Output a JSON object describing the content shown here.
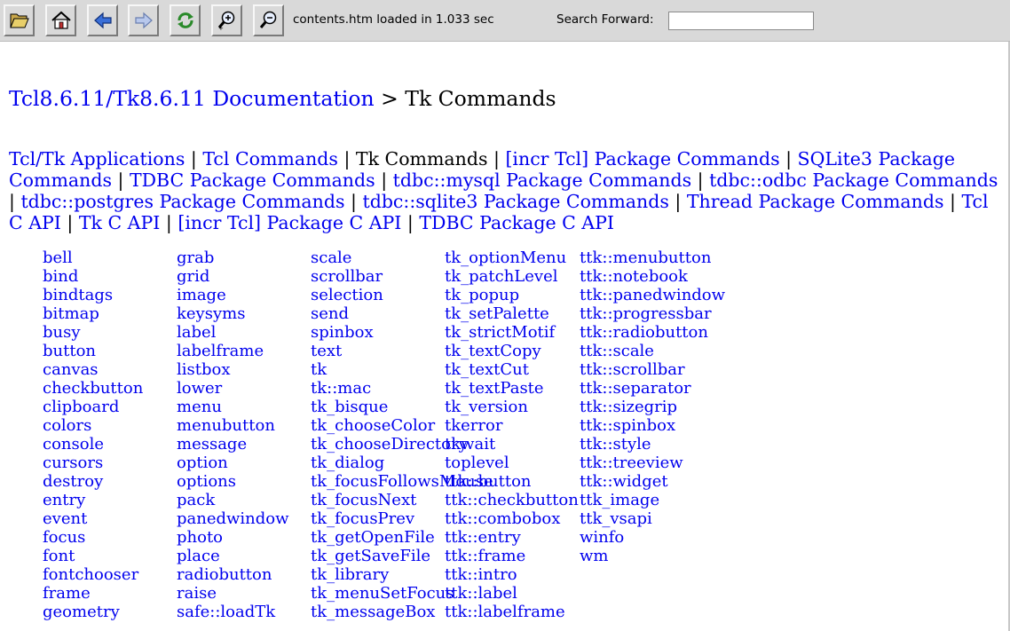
{
  "toolbar": {
    "buttons": [
      {
        "name": "open-folder-icon",
        "label": "Open"
      },
      {
        "name": "home-icon",
        "label": "Home"
      },
      {
        "name": "back-arrow-icon",
        "label": "Back"
      },
      {
        "name": "forward-arrow-icon",
        "label": "Forward"
      },
      {
        "name": "reload-icon",
        "label": "Reload"
      },
      {
        "name": "zoom-in-icon",
        "label": "Zoom in"
      },
      {
        "name": "zoom-out-icon",
        "label": "Zoom out"
      }
    ],
    "status": "contents.htm loaded in 1.033 sec",
    "search_label": "Search Forward:",
    "search_value": ""
  },
  "page": {
    "breadcrumb_link": "Tcl8.6.11/Tk8.6.11 Documentation",
    "breadcrumb_sep": " > ",
    "breadcrumb_current": "Tk Commands",
    "nav_links": [
      {
        "label": "Tcl/Tk Applications",
        "current": false
      },
      {
        "label": "Tcl Commands",
        "current": false
      },
      {
        "label": "Tk Commands",
        "current": true
      },
      {
        "label": "[incr Tcl] Package Commands",
        "current": false
      },
      {
        "label": "SQLite3 Package Commands",
        "current": false
      },
      {
        "label": "TDBC Package Commands",
        "current": false
      },
      {
        "label": "tdbc::mysql Package Commands",
        "current": false
      },
      {
        "label": "tdbc::odbc Package Commands",
        "current": false
      },
      {
        "label": "tdbc::postgres Package Commands",
        "current": false
      },
      {
        "label": "tdbc::sqlite3 Package Commands",
        "current": false
      },
      {
        "label": "Thread Package Commands",
        "current": false
      },
      {
        "label": "Tcl C API",
        "current": false
      },
      {
        "label": "Tk C API",
        "current": false
      },
      {
        "label": "[incr Tcl] Package C API",
        "current": false
      },
      {
        "label": "TDBC Package C API",
        "current": false
      }
    ],
    "nav_separator": " | ",
    "columns": [
      [
        "bell",
        "bind",
        "bindtags",
        "bitmap",
        "busy",
        "button",
        "canvas",
        "checkbutton",
        "clipboard",
        "colors",
        "console",
        "cursors",
        "destroy",
        "entry",
        "event",
        "focus",
        "font",
        "fontchooser",
        "frame",
        "geometry"
      ],
      [
        "grab",
        "grid",
        "image",
        "keysyms",
        "label",
        "labelframe",
        "listbox",
        "lower",
        "menu",
        "menubutton",
        "message",
        "option",
        "options",
        "pack",
        "panedwindow",
        "photo",
        "place",
        "radiobutton",
        "raise",
        "safe::loadTk"
      ],
      [
        "scale",
        "scrollbar",
        "selection",
        "send",
        "spinbox",
        "text",
        "tk",
        "tk::mac",
        "tk_bisque",
        "tk_chooseColor",
        "tk_chooseDirectory",
        "tk_dialog",
        "tk_focusFollowsMouse",
        "tk_focusNext",
        "tk_focusPrev",
        "tk_getOpenFile",
        "tk_getSaveFile",
        "tk_library",
        "tk_menuSetFocus",
        "tk_messageBox"
      ],
      [
        "tk_optionMenu",
        "tk_patchLevel",
        "tk_popup",
        "tk_setPalette",
        "tk_strictMotif",
        "tk_textCopy",
        "tk_textCut",
        "tk_textPaste",
        "tk_version",
        "tkerror",
        "tkwait",
        "toplevel",
        "ttk::button",
        "ttk::checkbutton",
        "ttk::combobox",
        "ttk::entry",
        "ttk::frame",
        "ttk::intro",
        "ttk::label",
        "ttk::labelframe"
      ],
      [
        "ttk::menubutton",
        "ttk::notebook",
        "ttk::panedwindow",
        "ttk::progressbar",
        "ttk::radiobutton",
        "ttk::scale",
        "ttk::scrollbar",
        "ttk::separator",
        "ttk::sizegrip",
        "ttk::spinbox",
        "ttk::style",
        "ttk::treeview",
        "ttk::widget",
        "ttk_image",
        "ttk_vsapi",
        "winfo",
        "wm"
      ]
    ]
  },
  "colors": {
    "link": "#0000ee",
    "toolbar_bg": "#d9d9d9"
  }
}
